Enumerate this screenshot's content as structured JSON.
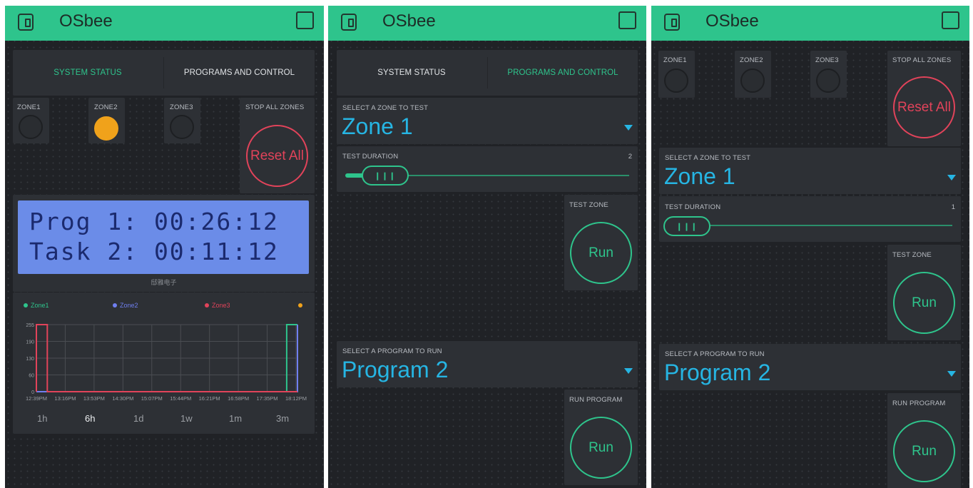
{
  "app": {
    "title": "OSbee"
  },
  "left": {
    "tabs": [
      "SYSTEM STATUS",
      "PROGRAMS AND CONTROL"
    ],
    "zones": [
      {
        "label": "ZONE1",
        "on": false
      },
      {
        "label": "ZONE2",
        "on": true
      },
      {
        "label": "ZONE3",
        "on": false
      }
    ],
    "stop_label": "STOP ALL ZONES",
    "reset_label": "Reset All",
    "lcd": {
      "line1": "Prog 1: 00:26:12",
      "line2": "Task 2: 00:11:12",
      "caption": "邸雅电子"
    },
    "ranges": [
      "1h",
      "6h",
      "1d",
      "1w",
      "1m",
      "3m"
    ],
    "active_range": "6h"
  },
  "middle": {
    "tabs": [
      "SYSTEM STATUS",
      "PROGRAMS AND CONTROL"
    ],
    "select_zone_label": "SELECT A ZONE TO TEST",
    "select_zone_value": "Zone 1",
    "duration_label": "TEST DURATION",
    "duration_value": "2",
    "test_zone_label": "TEST ZONE",
    "run_label": "Run",
    "select_program_label": "SELECT A PROGRAM TO RUN",
    "select_program_value": "Program 2",
    "run_program_label": "RUN PROGRAM",
    "run_program_button": "Run"
  },
  "right": {
    "zones": [
      {
        "label": "ZONE1",
        "on": false
      },
      {
        "label": "ZONE2",
        "on": false
      },
      {
        "label": "ZONE3",
        "on": false
      }
    ],
    "stop_label": "STOP ALL ZONES",
    "reset_label": "Reset All",
    "select_zone_label": "SELECT A ZONE TO TEST",
    "select_zone_value": "Zone 1",
    "duration_label": "TEST DURATION",
    "duration_value": "1",
    "test_zone_label": "TEST ZONE",
    "run_label": "Run",
    "select_program_label": "SELECT A PROGRAM TO RUN",
    "select_program_value": "Program 2",
    "run_program_label": "RUN PROGRAM",
    "run_program_button": "Run"
  },
  "colors": {
    "accent": "#2ec48c",
    "zone1": "#2ec48c",
    "zone2": "#6f7ff0",
    "zone3": "#e1435a",
    "zone4": "#f0a21b",
    "value": "#26b5e3"
  },
  "chart_data": {
    "type": "line",
    "title": "",
    "legend": [
      "Zone1",
      "Zone2",
      "Zone3",
      ""
    ],
    "x_tick_labels": [
      "12:39PM",
      "13:16PM",
      "13:53PM",
      "14:30PM",
      "15:07PM",
      "15:44PM",
      "16:21PM",
      "16:58PM",
      "17:35PM",
      "18:12PM"
    ],
    "y_tick_labels": [
      "255",
      "190",
      "130",
      "60",
      "0"
    ],
    "ylim": [
      0,
      255
    ],
    "series": [
      {
        "name": "Zone1",
        "color": "#2ec48c",
        "x": [
          "12:39PM",
          "18:00PM",
          "18:00PM",
          "18:25PM"
        ],
        "y": [
          0,
          0,
          255,
          255
        ]
      },
      {
        "name": "Zone2",
        "color": "#6f7ff0",
        "x": [
          "12:39PM",
          "18:17PM",
          "18:17PM",
          "18:25PM"
        ],
        "y": [
          0,
          0,
          255,
          255
        ]
      },
      {
        "name": "Zone3",
        "color": "#e1435a",
        "x": [
          "12:39PM",
          "12:39PM",
          "12:53PM",
          "12:53PM",
          "18:25PM"
        ],
        "y": [
          0,
          255,
          255,
          0,
          0
        ]
      }
    ]
  }
}
